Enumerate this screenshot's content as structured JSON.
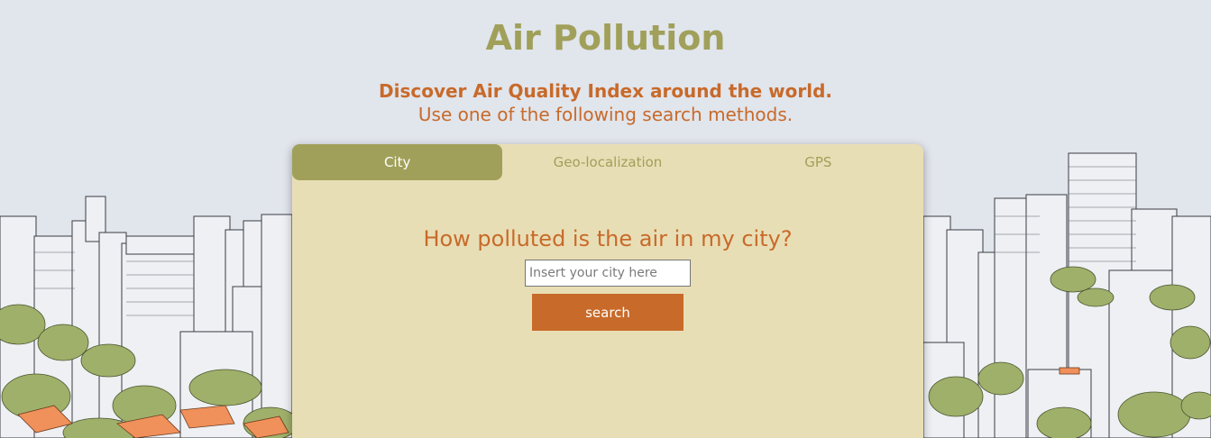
{
  "header": {
    "title": "Air Pollution",
    "subtitle": "Discover Air Quality Index around the world.",
    "instruction": "Use one of the following search methods."
  },
  "tabs": [
    {
      "label": "City",
      "active": true
    },
    {
      "label": "Geo-localization",
      "active": false
    },
    {
      "label": "GPS",
      "active": false
    }
  ],
  "city_search": {
    "question": "How polluted is the air in my city?",
    "placeholder": "Insert your city here",
    "value": "",
    "button_label": "search"
  },
  "colors": {
    "background": "#e1e5ec",
    "title_olive": "#a0a05a",
    "accent_orange": "#c86a2a",
    "card_beige": "#e8deb5"
  }
}
